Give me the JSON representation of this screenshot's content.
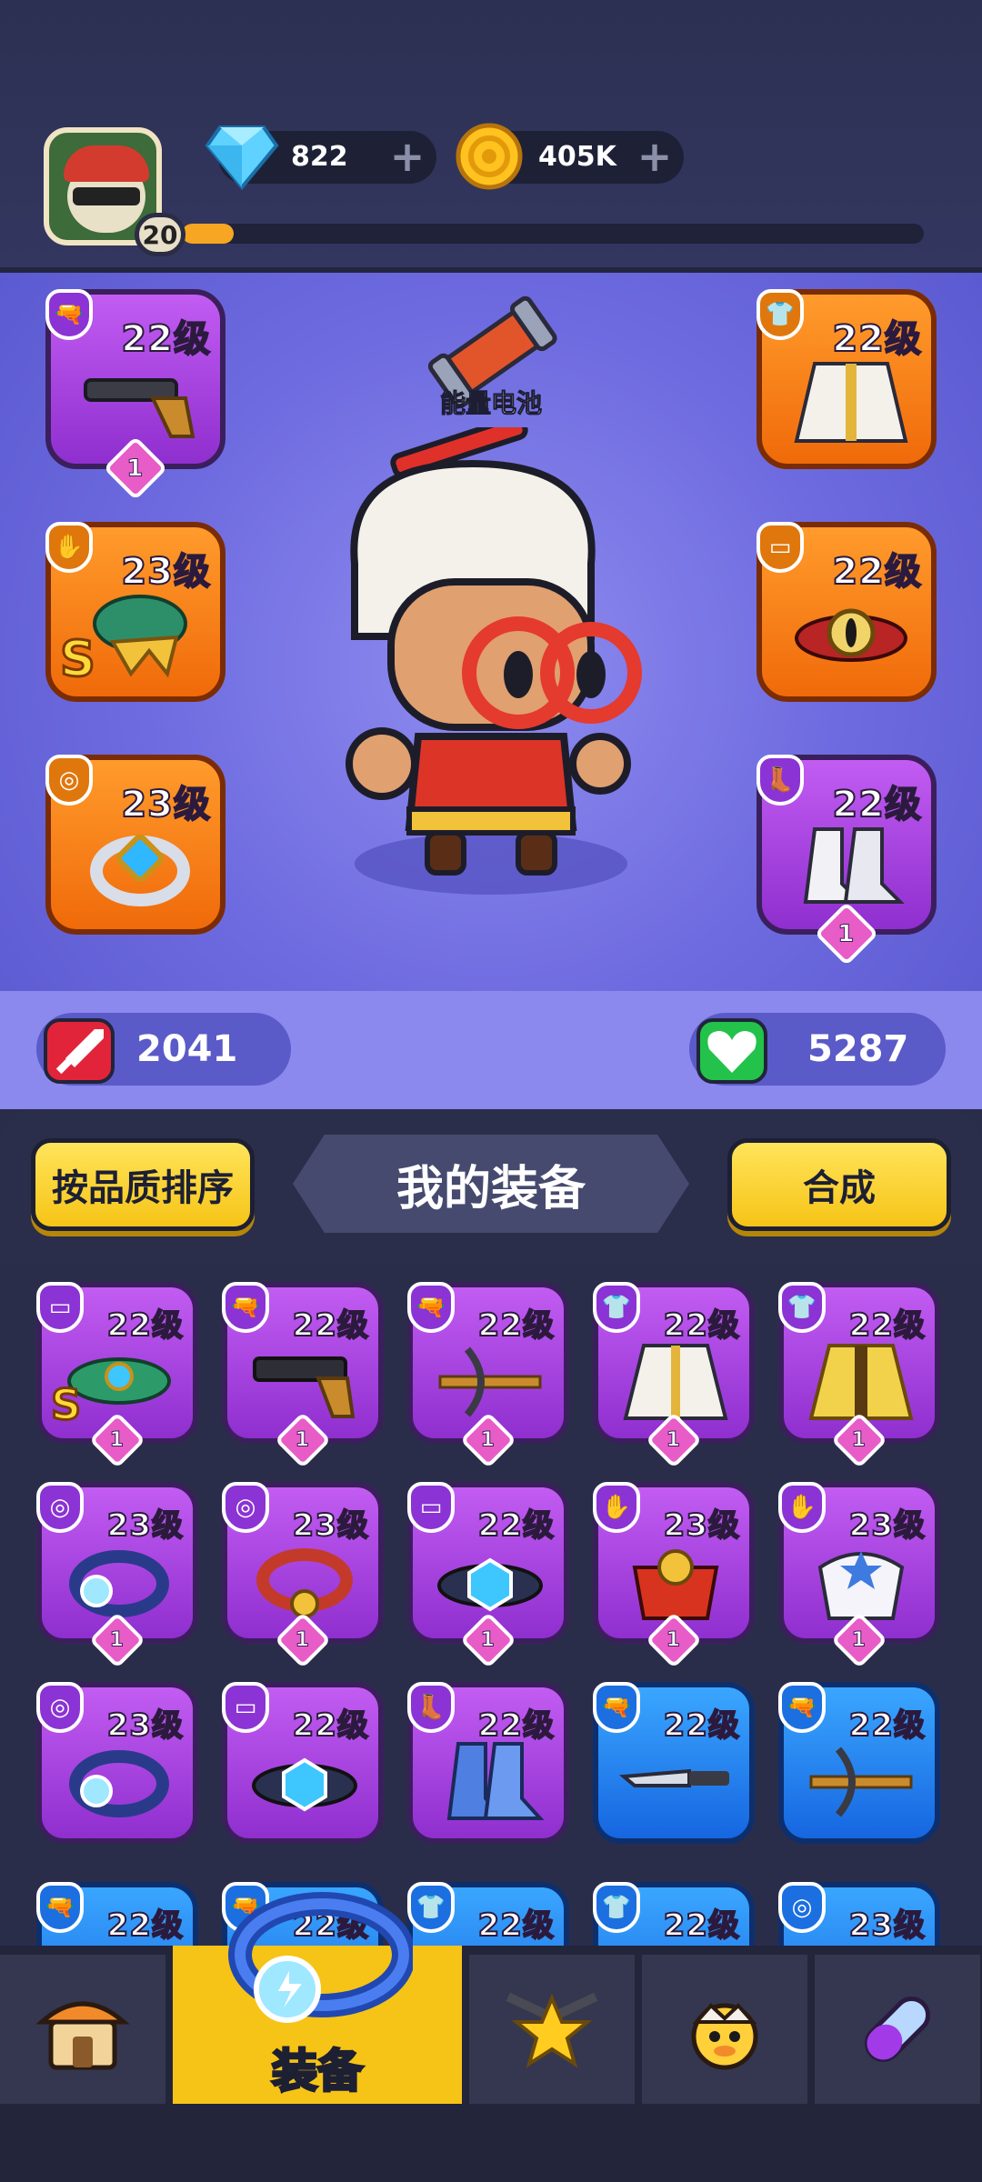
{
  "player": {
    "level": "20",
    "xp_progress": 0.07
  },
  "currency": {
    "gems": "822",
    "coins": "405K"
  },
  "hero": {
    "battery_label": "能量电池",
    "slots": [
      {
        "name": "weapon",
        "level_text": "22级",
        "rarity": "purple",
        "rank": "1"
      },
      {
        "name": "gloves",
        "level_text": "23级",
        "rarity": "orange",
        "tier_mark": "S"
      },
      {
        "name": "ring",
        "level_text": "23级",
        "rarity": "orange"
      },
      {
        "name": "armor",
        "level_text": "22级",
        "rarity": "orange"
      },
      {
        "name": "belt",
        "level_text": "22级",
        "rarity": "orange"
      },
      {
        "name": "boots",
        "level_text": "22级",
        "rarity": "purple",
        "rank": "1"
      }
    ],
    "stats": {
      "attack": "2041",
      "health": "5287"
    }
  },
  "inventory": {
    "sort_label": "按品质排序",
    "title": "我的装备",
    "merge_label": "合成",
    "items": [
      {
        "level_text": "22级",
        "rarity": "purple",
        "rank": "1",
        "type": "belt",
        "tier_mark": "S"
      },
      {
        "level_text": "22级",
        "rarity": "purple",
        "rank": "1",
        "type": "weapon"
      },
      {
        "level_text": "22级",
        "rarity": "purple",
        "rank": "1",
        "type": "weapon"
      },
      {
        "level_text": "22级",
        "rarity": "purple",
        "rank": "1",
        "type": "armor"
      },
      {
        "level_text": "22级",
        "rarity": "purple",
        "rank": "1",
        "type": "armor"
      },
      {
        "level_text": "23级",
        "rarity": "purple",
        "rank": "1",
        "type": "ring"
      },
      {
        "level_text": "23级",
        "rarity": "purple",
        "rank": "1",
        "type": "ring"
      },
      {
        "level_text": "22级",
        "rarity": "purple",
        "rank": "1",
        "type": "belt"
      },
      {
        "level_text": "23级",
        "rarity": "purple",
        "rank": "1",
        "type": "gloves"
      },
      {
        "level_text": "23级",
        "rarity": "purple",
        "rank": "1",
        "type": "gloves"
      },
      {
        "level_text": "23级",
        "rarity": "purple",
        "type": "ring"
      },
      {
        "level_text": "22级",
        "rarity": "purple",
        "type": "belt"
      },
      {
        "level_text": "22级",
        "rarity": "purple",
        "type": "boots"
      },
      {
        "level_text": "22级",
        "rarity": "blue",
        "type": "weapon"
      },
      {
        "level_text": "22级",
        "rarity": "blue",
        "type": "weapon"
      },
      {
        "level_text": "22级",
        "rarity": "blue",
        "type": "weapon"
      },
      {
        "level_text": "22级",
        "rarity": "blue",
        "type": "weapon"
      },
      {
        "level_text": "22级",
        "rarity": "blue",
        "type": "armor"
      },
      {
        "level_text": "22级",
        "rarity": "blue",
        "type": "armor"
      },
      {
        "level_text": "23级",
        "rarity": "blue",
        "type": "ring"
      }
    ]
  },
  "nav": {
    "tabs": [
      {
        "name": "shop",
        "icon": "shop-icon"
      },
      {
        "name": "equipment",
        "icon": "ring-icon",
        "label": "装备",
        "active": true
      },
      {
        "name": "battle",
        "icon": "star-swords-icon"
      },
      {
        "name": "pets",
        "icon": "duck-egg-icon"
      },
      {
        "name": "talents",
        "icon": "capsule-icon"
      }
    ]
  },
  "colors": {
    "purple": "#a547e6",
    "orange": "#f47f14",
    "blue": "#2080f0",
    "accent_yellow": "#f6c417",
    "attack_red": "#e2243a",
    "health_green": "#23c24a"
  }
}
